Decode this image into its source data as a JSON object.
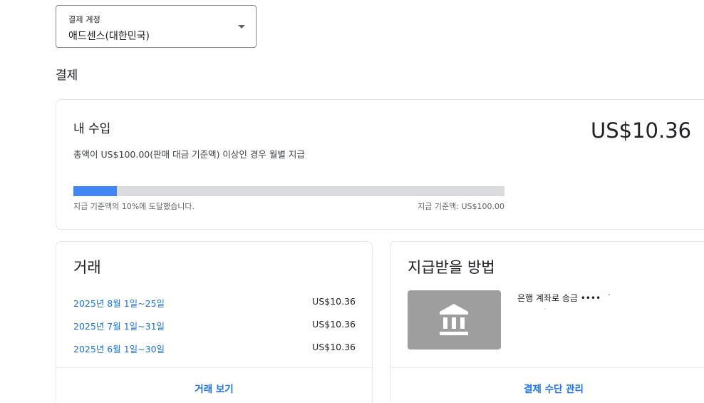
{
  "billing_account": {
    "label": "결제 계정",
    "value": "애드센스(대한민국)"
  },
  "section_title": "결제",
  "earnings": {
    "title": "내 수입",
    "description": "총액이 US$100.00(판매 대금 기준액) 이상인 경우 월별 지급",
    "amount": "US$10.36",
    "progress_percent": 10,
    "progress_text": "지급 기준액의 10%에 도달했습니다.",
    "threshold_text": "지급 기준액: US$100.00"
  },
  "transactions": {
    "title": "거래",
    "rows": [
      {
        "period": "2025년 8월 1일~25일",
        "amount": "US$10.36"
      },
      {
        "period": "2025년 7월 1일~31일",
        "amount": "US$10.36"
      },
      {
        "period": "2025년 6월 1일~30일",
        "amount": "US$10.36"
      }
    ],
    "view_link": "거래 보기"
  },
  "payment_method": {
    "title": "지급받을 방법",
    "icon": "bank-icon",
    "method_text": "은행 계좌로 송금 ••••",
    "manage_link": "결제 수단 관리"
  },
  "colors": {
    "accent": "#1a73e8",
    "progress_fill": "#4285f4",
    "progress_track": "#dadce0",
    "bank_tile": "#9e9e9e"
  }
}
